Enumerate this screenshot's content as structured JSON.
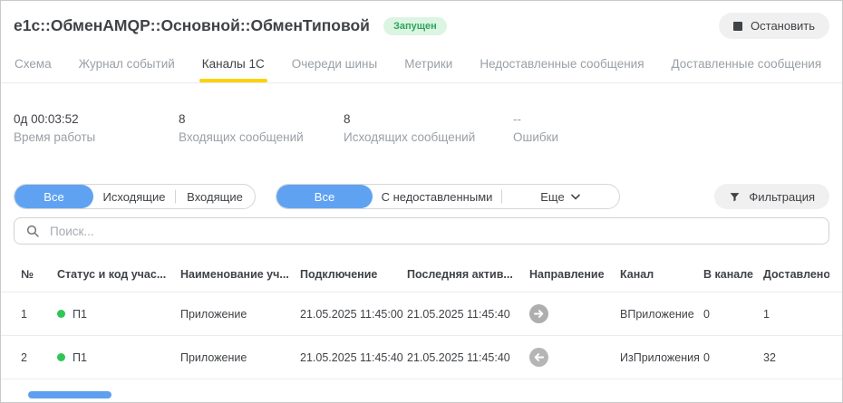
{
  "header": {
    "title": "e1c::ОбменAMQP::Основной::ОбменТиповой",
    "status_badge": "Запущен",
    "stop_button": "Остановить"
  },
  "tabs": [
    {
      "label": "Схема",
      "active": false
    },
    {
      "label": "Журнал событий",
      "active": false
    },
    {
      "label": "Каналы 1С",
      "active": true
    },
    {
      "label": "Очереди шины",
      "active": false
    },
    {
      "label": "Метрики",
      "active": false
    },
    {
      "label": "Недоставленные сообщения",
      "active": false
    },
    {
      "label": "Доставленные сообщения",
      "active": false
    }
  ],
  "stats": [
    {
      "value": "0д 00:03:52",
      "label": "Время работы",
      "muted": false
    },
    {
      "value": "8",
      "label": "Входящих сообщений",
      "muted": false
    },
    {
      "value": "8",
      "label": "Исходящих сообщений",
      "muted": false
    },
    {
      "value": "--",
      "label": "Ошибки",
      "muted": true
    }
  ],
  "filters": {
    "direction": [
      "Все",
      "Исходящие",
      "Входящие"
    ],
    "direction_selected": "Все",
    "delivery": [
      "Все",
      "С недоставленными"
    ],
    "delivery_selected": "Все",
    "more_label": "Еще",
    "filter_button": "Фильтрация"
  },
  "search": {
    "placeholder": "Поиск..."
  },
  "table": {
    "columns": [
      "№",
      "Статус и код учас...",
      "Наименование уч...",
      "Подключение",
      "Последняя актив...",
      "Направление",
      "Канал",
      "В канале",
      "Доставлено"
    ],
    "rows": [
      {
        "num": "1",
        "status_code": "П1",
        "name": "Приложение",
        "connected": "21.05.2025 11:45:00",
        "last_activity": "21.05.2025 11:45:40",
        "direction": "outgoing",
        "channel": "ВПриложение",
        "in_channel": "0",
        "delivered": "1"
      },
      {
        "num": "2",
        "status_code": "П1",
        "name": "Приложение",
        "connected": "21.05.2025 11:45:40",
        "last_activity": "21.05.2025 11:45:40",
        "direction": "incoming",
        "channel": "ИзПриложения",
        "in_channel": "0",
        "delivered": "32"
      }
    ]
  },
  "icons": {
    "stop": "stop-square",
    "filter": "funnel",
    "search": "magnifier",
    "more": "chevron-down",
    "outgoing": "arrow-right-in-circle",
    "incoming": "arrow-left-in-circle",
    "status": "green-dot"
  },
  "colors": {
    "accent_blue": "#60a2f2",
    "tab_underline_yellow": "#fcd205",
    "status_green": "#2fc656",
    "badge_bg": "#dbf5e2",
    "badge_text": "#2da55c",
    "direction_icon_gray": "#aeaeae",
    "muted_text": "#9aa0a6"
  }
}
